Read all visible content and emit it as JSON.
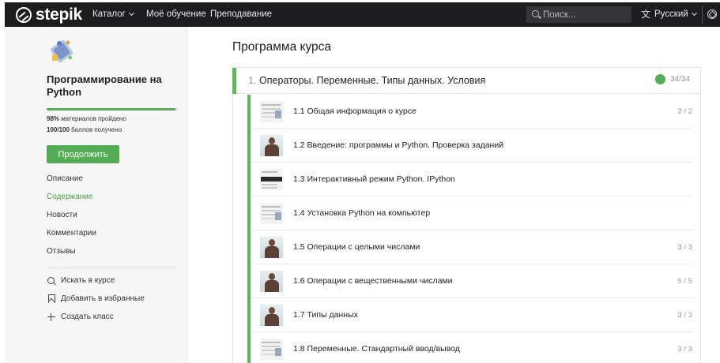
{
  "topbar": {
    "logo_text": "stepik",
    "nav": {
      "catalog": "Каталог",
      "my_learning": "Моё обучение",
      "teaching": "Преподавание"
    },
    "search_placeholder": "Поиск...",
    "language": "Русский"
  },
  "sidebar": {
    "course_title": "Программирование на Python",
    "progress_fraction": 0.98,
    "materials_percent": "98%",
    "materials_text": "материалов пройдено",
    "points_value": "100/100",
    "points_text": "баллов получено",
    "continue_label": "Продолжить",
    "menu": [
      {
        "label": "Описание",
        "active": false
      },
      {
        "label": "Содержание",
        "active": true
      },
      {
        "label": "Новости",
        "active": false
      },
      {
        "label": "Комментарии",
        "active": false
      },
      {
        "label": "Отзывы",
        "active": false
      }
    ],
    "actions": [
      {
        "icon": "search-icon",
        "label": "Искать в курсе"
      },
      {
        "icon": "bookmark-icon",
        "label": "Добавить в избранные"
      },
      {
        "icon": "plus-icon",
        "label": "Создать класс"
      }
    ]
  },
  "main": {
    "page_title": "Программа курса",
    "module": {
      "number": "1.",
      "title": "Операторы. Переменные. Типы данных. Условия",
      "progress": "34/34",
      "lessons": [
        {
          "title": "1.1 Общая информация о курсе",
          "score": "2 / 2",
          "thumb": "slide"
        },
        {
          "title": "1.2 Введение: программы и Python. Проверка заданий",
          "score": "",
          "thumb": "person"
        },
        {
          "title": "1.3 Интерактивный режим Python. IPython",
          "score": "",
          "thumb": "dark"
        },
        {
          "title": "1.4 Установка Python на компьютер",
          "score": "",
          "thumb": "slide"
        },
        {
          "title": "1.5 Операции с целыми числами",
          "score": "3 / 3",
          "thumb": "person"
        },
        {
          "title": "1.6 Операции с вещественными числами",
          "score": "5 / 5",
          "thumb": "person"
        },
        {
          "title": "1.7 Типы данных",
          "score": "3 / 3",
          "thumb": "person"
        },
        {
          "title": "1.8 Переменные. Стандартный ввод/вывод",
          "score": "3 / 3",
          "thumb": "slide"
        }
      ]
    }
  },
  "colors": {
    "accent_green": "#54ad54",
    "topbar_bg": "#1d1d1f"
  }
}
